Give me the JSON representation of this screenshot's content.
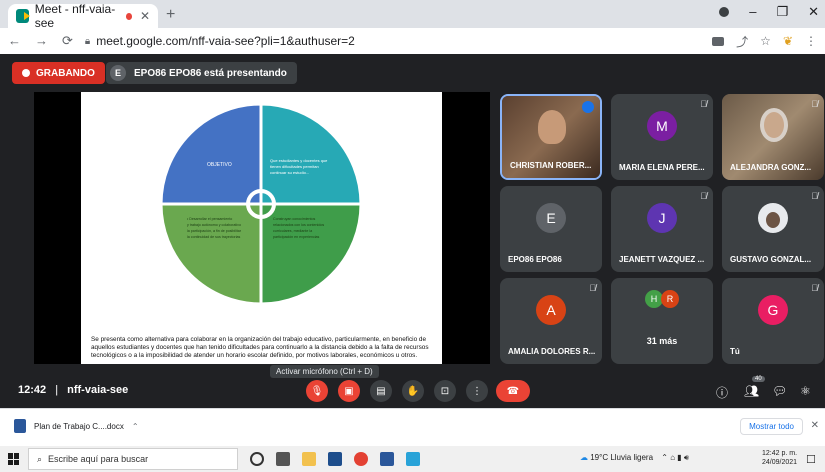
{
  "browser": {
    "tab_title": "Meet - nff-vaia-see",
    "url": "meet.google.com/nff-vaia-see?pli=1&authuser=2",
    "new_tab": "+"
  },
  "meet": {
    "recording_label": "GRABANDO",
    "presenter_initial": "E",
    "presenter_text": "EPO86 EPO86 está presentando",
    "slide": {
      "quadrants": [
        "OBJETIVO",
        "Que estudiantes y docentes que tienen dificultades permitan continuar su estudio y sus actividades sean a la comunidad..."
      ],
      "caption": "Se presenta como alternativa para colaborar en la organización del trabajo educativo, particularmente, en beneficio de aquellos estudiantes y docentes que han tenido dificultades para continuarlo a la distancia debido a la falta de recursos tecnológicos o a la imposibilidad de atender un horario escolar definido, por motivos laborales, económicos u otros."
    },
    "participants": [
      {
        "name": "CHRISTIAN ROBER..."
      },
      {
        "name": "MARIA ELENA PERE...",
        "initial": "M",
        "color": "#1a73e8"
      },
      {
        "name": "ALEJANDRA GONZ..."
      },
      {
        "name": "EPO86 EPO86",
        "initial": "E",
        "color": "#5f6368"
      },
      {
        "name": "JEANETT VAZQUEZ ...",
        "initial": "J",
        "color": "#1a73e8"
      },
      {
        "name": "GUSTAVO GONZAL..."
      },
      {
        "name": "AMALIA DOLORES R...",
        "initial": "A",
        "color": "#d93025"
      },
      {
        "more_label": "31 más",
        "initials": [
          "H",
          "R"
        ]
      },
      {
        "name": "Tú",
        "initial": "G",
        "color": "#e91e63"
      }
    ],
    "tooltip": "Activar micrófono (Ctrl + D)",
    "time": "12:42",
    "separator": "|",
    "meeting_code": "nff-vaia-see",
    "people_count": "40"
  },
  "download": {
    "file_name": "Plan de Trabajo C....docx",
    "show_all": "Mostrar todo"
  },
  "taskbar": {
    "search_placeholder": "Escribe aquí para buscar",
    "weather": "19°C  Lluvia ligera",
    "time": "12:42 p. m.",
    "date": "24/09/2021"
  }
}
